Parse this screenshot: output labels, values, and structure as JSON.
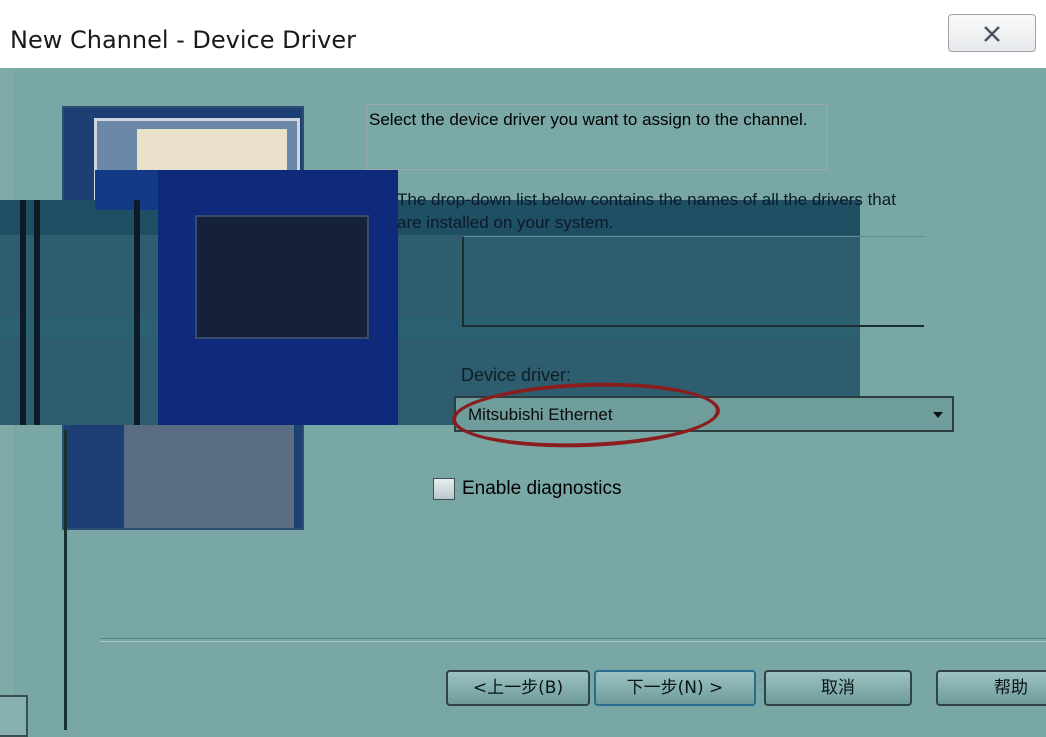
{
  "window": {
    "title": "New Channel - Device Driver"
  },
  "description": {
    "line1": "Select the device driver you want to assign to the channel.",
    "line2": "The drop-down list below contains the names of all the drivers that are installed on your system."
  },
  "device_driver": {
    "label": "Device driver:",
    "value": "Mitsubishi Ethernet"
  },
  "diagnostics": {
    "label": "Enable diagnostics",
    "checked": false
  },
  "buttons": {
    "back": "<上一步(B)",
    "next": "下一步(N) >",
    "cancel": "取消",
    "help": "帮助"
  },
  "colors": {
    "panel": "#78a7a6",
    "annotation_ellipse": "#8a1e1e"
  },
  "icons": [
    "close-icon",
    "dropdown-arrow-icon",
    "wizard-illustration-image"
  ]
}
